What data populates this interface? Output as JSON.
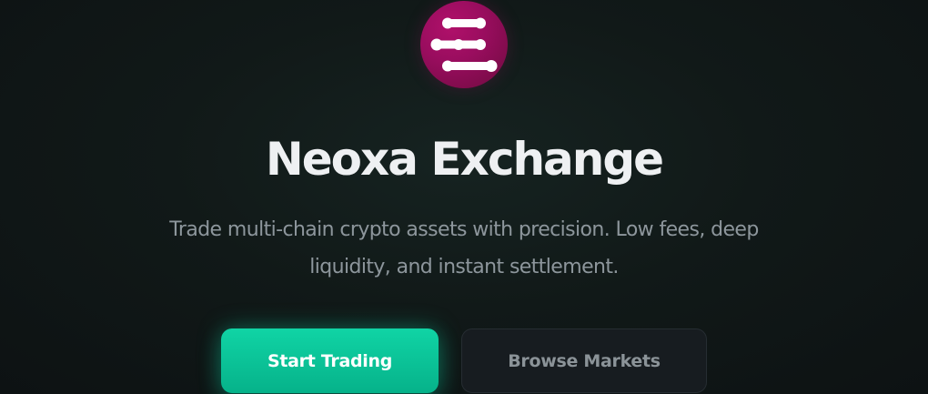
{
  "hero": {
    "logo_icon": "neoxa-logo-icon",
    "title": "Neoxa Exchange",
    "subtitle": "Trade multi-chain crypto assets with precision. Low fees, deep liquidity, and instant settlement."
  },
  "actions": {
    "primary_label": "Start Trading",
    "secondary_label": "Browse Markets"
  },
  "colors": {
    "logo_magenta": "#9a0d5f",
    "accent_green": "#10d4a5",
    "background": "#111918",
    "title_text": "#eef0f2",
    "subtitle_text": "#8d969c"
  }
}
